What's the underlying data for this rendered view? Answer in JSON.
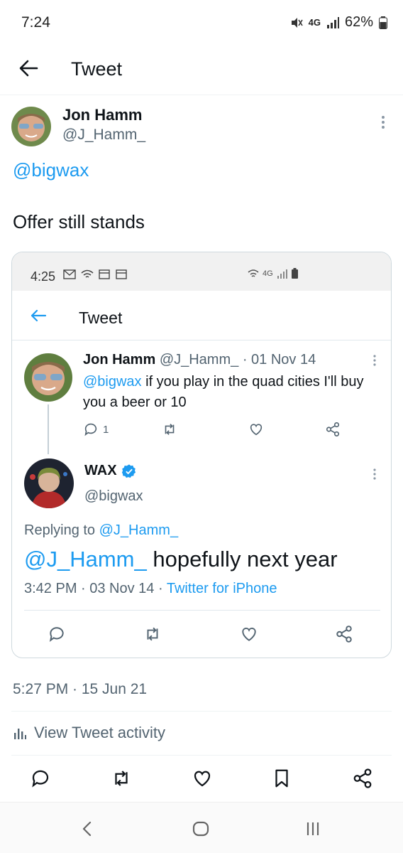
{
  "status_bar": {
    "time": "7:24",
    "network": "4G",
    "battery": "62%"
  },
  "header": {
    "title": "Tweet"
  },
  "tweet": {
    "author_name": "Jon Hamm",
    "author_handle": "@J_Hamm_",
    "mention": "@bigwax",
    "text": "Offer still stands",
    "timestamp": "5:27 PM · 15 Jun 21",
    "activity_label": "View Tweet activity"
  },
  "embedded": {
    "status_time": "4:25",
    "status_network": "4G",
    "title": "Tweet",
    "quoted": {
      "name": "Jon Hamm",
      "handle": "@J_Hamm_",
      "date": "· 01 Nov 14",
      "mention": "@bigwax",
      "text": " if you play in the quad cities I'll buy you a beer or 10",
      "reply_count": "1"
    },
    "reply": {
      "name": "WAX",
      "handle": "@bigwax",
      "replying_prefix": "Replying to ",
      "replying_handle": "@J_Hamm_",
      "mention": "@J_Hamm_",
      "text": " hopefully next year",
      "meta_time": "3:42 PM · 03 Nov 14 · ",
      "meta_source": "Twitter for iPhone"
    }
  },
  "colors": {
    "accent": "#1d9bf0",
    "secondary_text": "#536471",
    "verified": "#1d9bf0"
  },
  "icons": [
    "back-arrow-icon",
    "more-icon",
    "reply-icon",
    "retweet-icon",
    "like-icon",
    "bookmark-icon",
    "share-icon",
    "verified-icon",
    "activity-chart-icon",
    "nav-back-icon",
    "nav-home-icon",
    "nav-recents-icon"
  ]
}
